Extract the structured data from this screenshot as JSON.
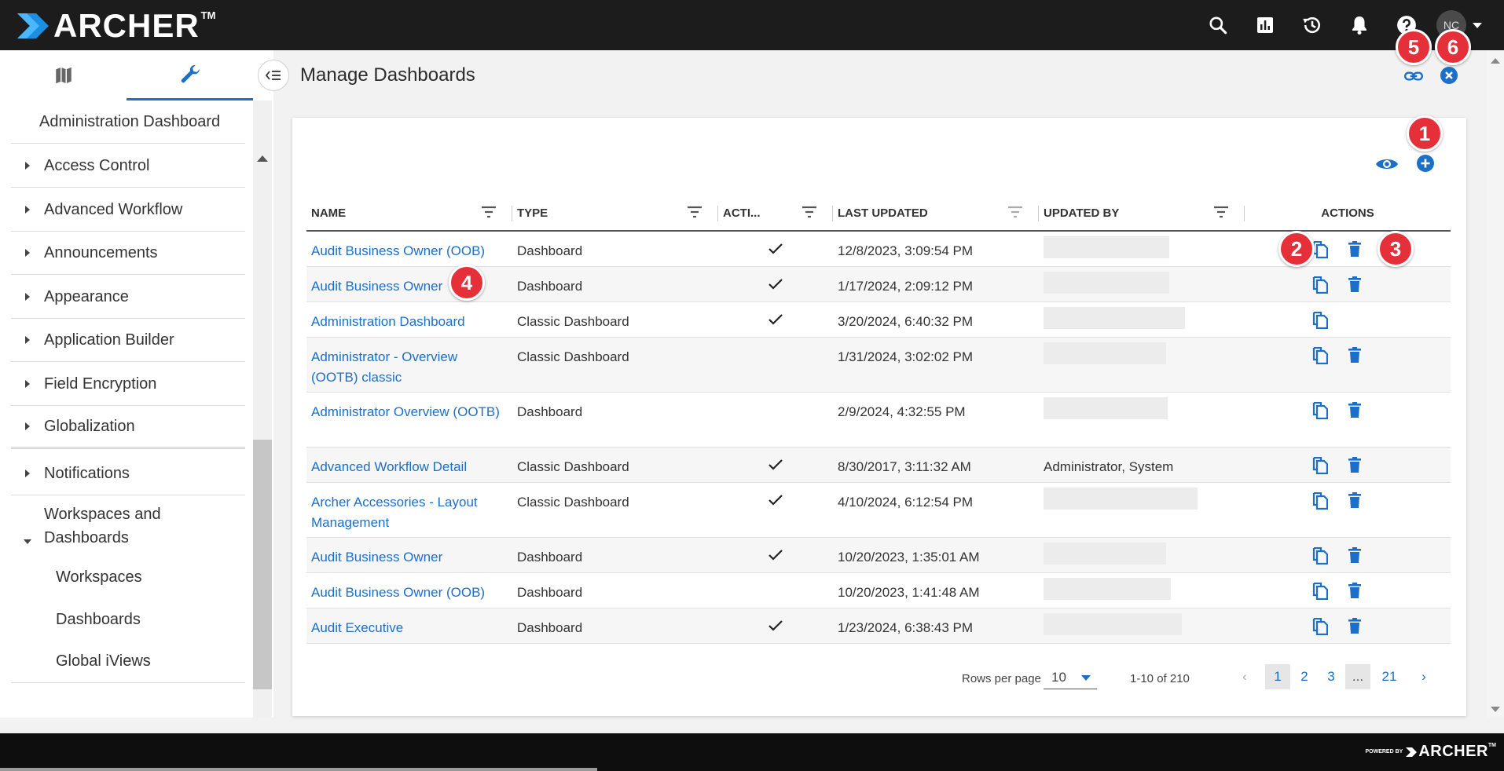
{
  "brand": {
    "logo": "ARCHER",
    "tm": "TM",
    "footer_powered": "POWERED BY",
    "footer_logo": "ARCHER",
    "footer_tm": "TM"
  },
  "colors": {
    "accent": "#1c6fc8",
    "topbar": "#1c1c1c",
    "badge": "#e5303a"
  },
  "topbar": {
    "icons": [
      "search-icon",
      "reports-icon",
      "history-icon",
      "notifications-icon",
      "help-icon"
    ],
    "avatar": "NC"
  },
  "sidebar": {
    "tabs": [
      "map-icon",
      "wrench-icon"
    ],
    "items": [
      {
        "label": "Administration Dashboard"
      },
      {
        "label": "Access Control"
      },
      {
        "label": "Advanced Workflow"
      },
      {
        "label": "Announcements"
      },
      {
        "label": "Appearance"
      },
      {
        "label": "Application Builder"
      },
      {
        "label": "Field Encryption"
      },
      {
        "label": "Globalization"
      },
      {
        "label": "Notifications"
      },
      {
        "label": "Workspaces and Dashboards"
      }
    ],
    "subitems": [
      {
        "label": "Workspaces"
      },
      {
        "label": "Dashboards"
      },
      {
        "label": "Global iViews"
      }
    ]
  },
  "header": {
    "title": "Manage Dashboards"
  },
  "table": {
    "columns": [
      "NAME",
      "TYPE",
      "ACTI...",
      "LAST UPDATED",
      "UPDATED BY",
      "ACTIONS"
    ],
    "rows": [
      {
        "name": "Audit Business Owner (OOB)",
        "type": "Dashboard",
        "active": "✓",
        "updated": "12/8/2023, 3:09:54 PM",
        "by": ""
      },
      {
        "name": "Audit Business Owner",
        "type": "Dashboard",
        "active": "✓",
        "updated": "1/17/2024, 2:09:12 PM",
        "by": ""
      },
      {
        "name": "Administration Dashboard",
        "type": "Classic Dashboard",
        "active": "✓",
        "updated": "3/20/2024, 6:40:32 PM",
        "by": ""
      },
      {
        "name": "Administrator - Overview (OOTB) classic",
        "type": "Classic Dashboard",
        "active": "",
        "updated": "1/31/2024, 3:02:02 PM",
        "by": ""
      },
      {
        "name": "Administrator Overview (OOTB)",
        "type": "Dashboard",
        "active": "",
        "updated": "2/9/2024, 4:32:55 PM",
        "by": ""
      },
      {
        "name": "Advanced Workflow Detail",
        "type": "Classic Dashboard",
        "active": "✓",
        "updated": "8/30/2017, 3:11:32 AM",
        "by": "Administrator, System"
      },
      {
        "name": "Archer Accessories - Layout Management",
        "type": "Classic Dashboard",
        "active": "✓",
        "updated": "4/10/2024, 6:12:54 PM",
        "by": ""
      },
      {
        "name": "Audit Business Owner",
        "type": "Dashboard",
        "active": "✓",
        "updated": "10/20/2023, 1:35:01 AM",
        "by": ""
      },
      {
        "name": "Audit Business Owner (OOB)",
        "type": "Dashboard",
        "active": "",
        "updated": "10/20/2023, 1:41:48 AM",
        "by": ""
      },
      {
        "name": "Audit Executive",
        "type": "Dashboard",
        "active": "✓",
        "updated": "1/23/2024, 6:38:43 PM",
        "by": ""
      }
    ]
  },
  "pagination": {
    "rows_per_page_label": "Rows per page",
    "rows_per_page": "10",
    "range": "1-10 of 210",
    "prev": "‹",
    "pages": [
      "1",
      "2",
      "3",
      "...",
      "21"
    ],
    "next": "›"
  },
  "badges": [
    "1",
    "2",
    "3",
    "4",
    "5",
    "6"
  ]
}
